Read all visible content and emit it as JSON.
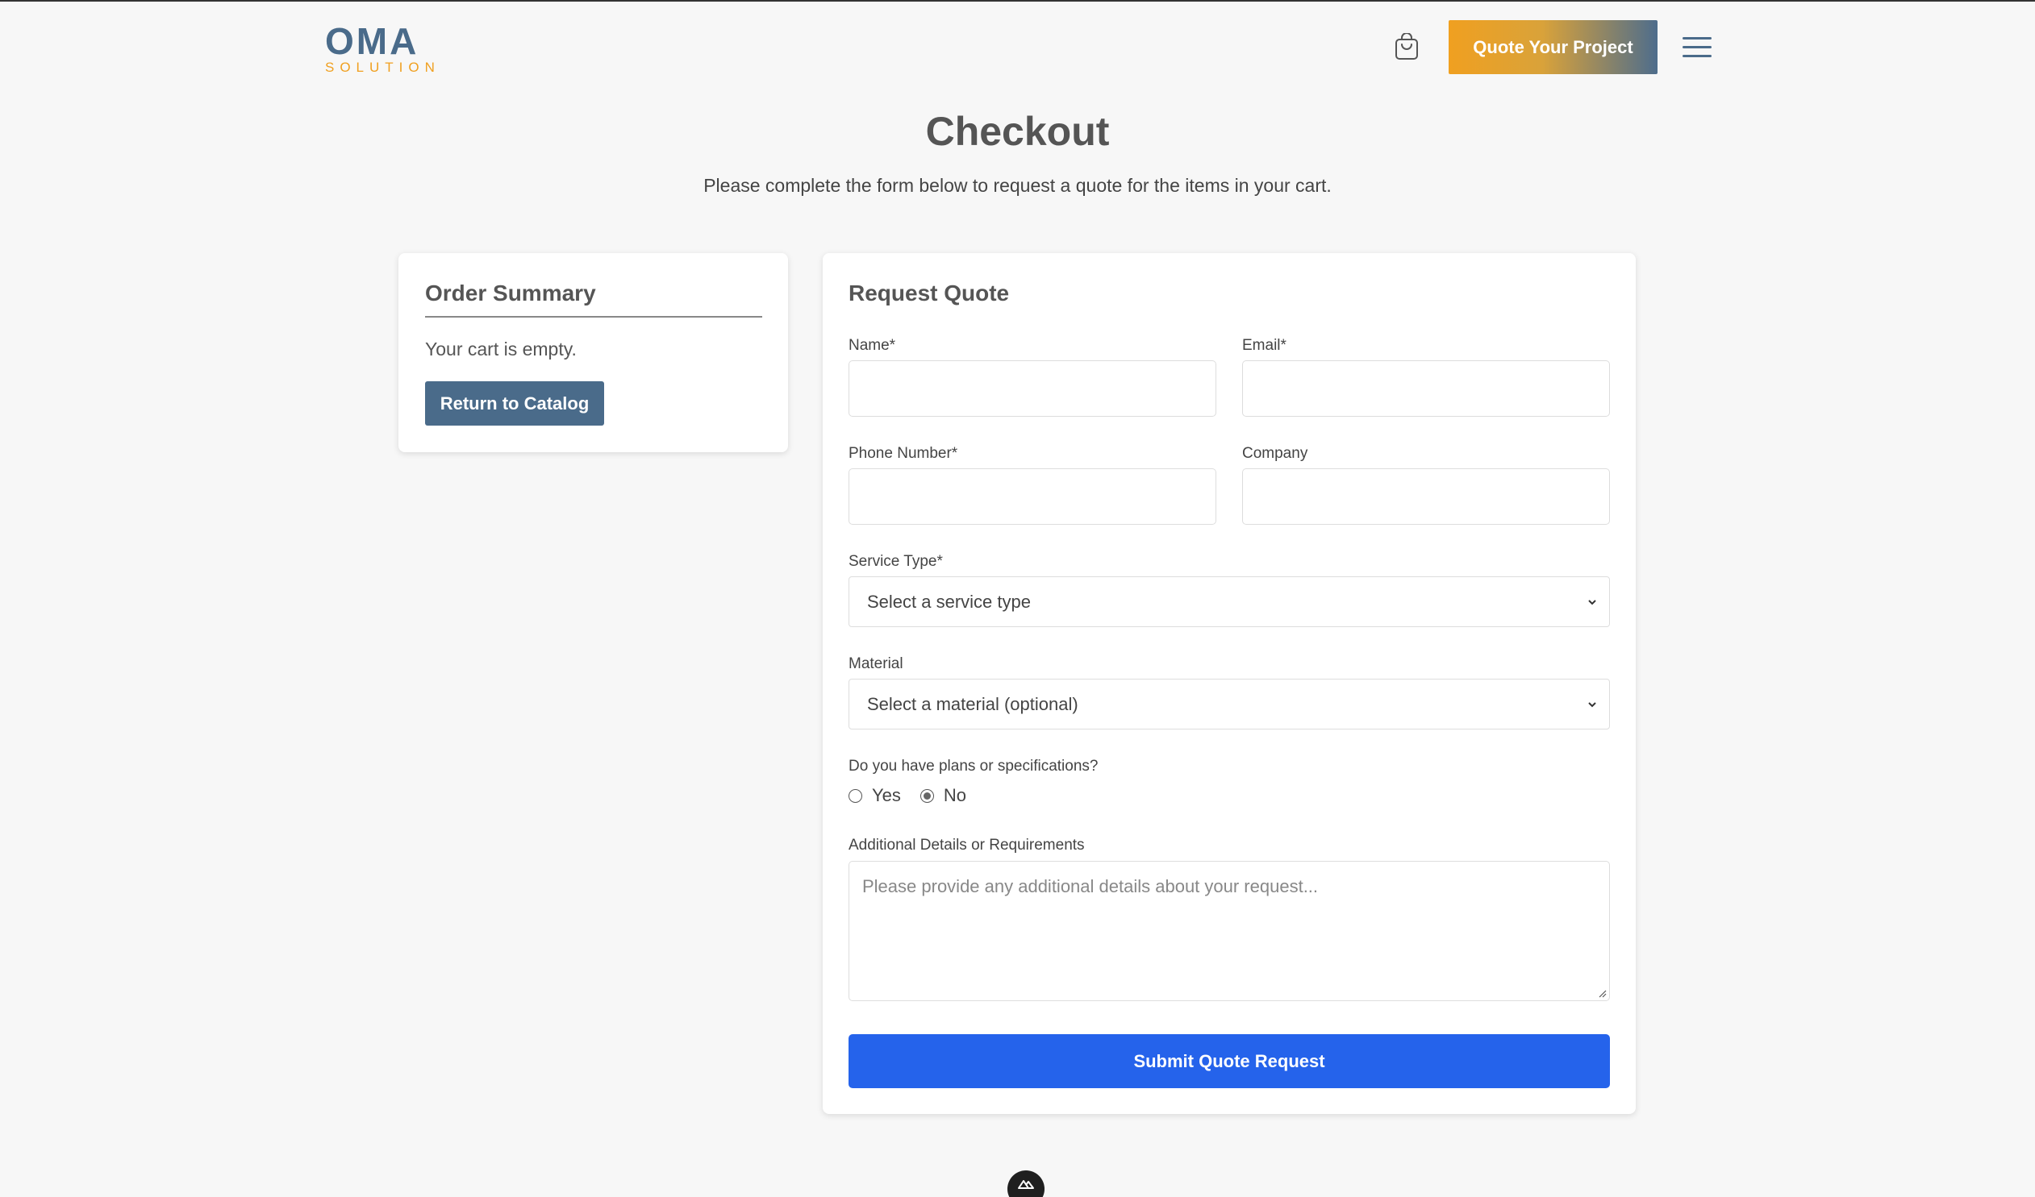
{
  "header": {
    "logo_main": "OMA",
    "logo_sub": "SOLUTION",
    "cta_label": "Quote Your Project",
    "cart_icon": "shopping-bag-icon",
    "menu_icon": "hamburger-menu-icon"
  },
  "page": {
    "title": "Checkout",
    "subtitle": "Please complete the form below to request a quote for the items in your cart."
  },
  "order_summary": {
    "title": "Order Summary",
    "empty_text": "Your cart is empty.",
    "return_label": "Return to Catalog"
  },
  "quote_form": {
    "title": "Request Quote",
    "name_label": "Name*",
    "email_label": "Email*",
    "phone_label": "Phone Number*",
    "company_label": "Company",
    "service_label": "Service Type*",
    "service_selected": "Select a service type",
    "material_label": "Material",
    "material_selected": "Select a material (optional)",
    "plans_label": "Do you have plans or specifications?",
    "plans_options": [
      "Yes",
      "No"
    ],
    "plans_selected": "No",
    "details_label": "Additional Details or Requirements",
    "details_placeholder": "Please provide any additional details about your request...",
    "submit_label": "Submit Quote Request"
  },
  "colors": {
    "brand_blue": "#4a6b8a",
    "brand_orange": "#f0a020",
    "submit_blue": "#2563eb",
    "background": "#f7f7f7"
  }
}
